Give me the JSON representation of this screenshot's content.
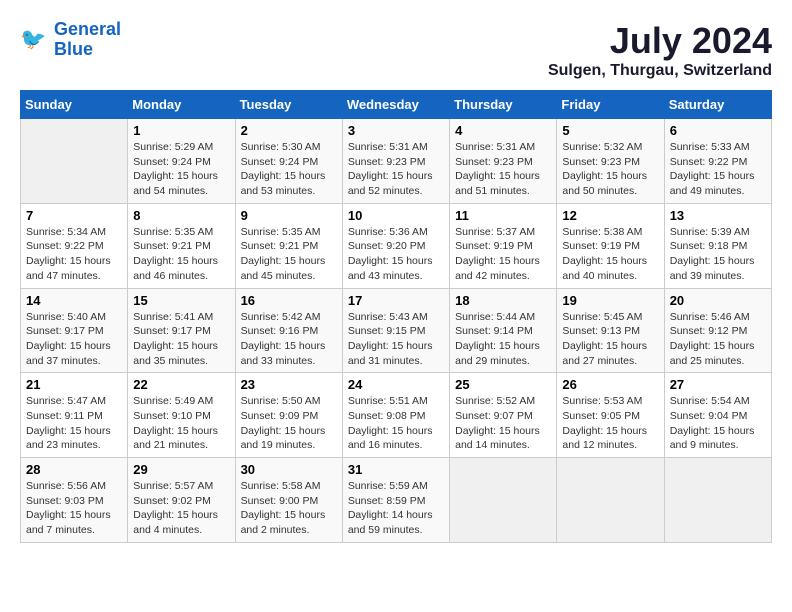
{
  "header": {
    "logo_line1": "General",
    "logo_line2": "Blue",
    "month_year": "July 2024",
    "location": "Sulgen, Thurgau, Switzerland"
  },
  "columns": [
    "Sunday",
    "Monday",
    "Tuesday",
    "Wednesday",
    "Thursday",
    "Friday",
    "Saturday"
  ],
  "weeks": [
    [
      {
        "day": "",
        "info": ""
      },
      {
        "day": "1",
        "info": "Sunrise: 5:29 AM\nSunset: 9:24 PM\nDaylight: 15 hours\nand 54 minutes."
      },
      {
        "day": "2",
        "info": "Sunrise: 5:30 AM\nSunset: 9:24 PM\nDaylight: 15 hours\nand 53 minutes."
      },
      {
        "day": "3",
        "info": "Sunrise: 5:31 AM\nSunset: 9:23 PM\nDaylight: 15 hours\nand 52 minutes."
      },
      {
        "day": "4",
        "info": "Sunrise: 5:31 AM\nSunset: 9:23 PM\nDaylight: 15 hours\nand 51 minutes."
      },
      {
        "day": "5",
        "info": "Sunrise: 5:32 AM\nSunset: 9:23 PM\nDaylight: 15 hours\nand 50 minutes."
      },
      {
        "day": "6",
        "info": "Sunrise: 5:33 AM\nSunset: 9:22 PM\nDaylight: 15 hours\nand 49 minutes."
      }
    ],
    [
      {
        "day": "7",
        "info": "Sunrise: 5:34 AM\nSunset: 9:22 PM\nDaylight: 15 hours\nand 47 minutes."
      },
      {
        "day": "8",
        "info": "Sunrise: 5:35 AM\nSunset: 9:21 PM\nDaylight: 15 hours\nand 46 minutes."
      },
      {
        "day": "9",
        "info": "Sunrise: 5:35 AM\nSunset: 9:21 PM\nDaylight: 15 hours\nand 45 minutes."
      },
      {
        "day": "10",
        "info": "Sunrise: 5:36 AM\nSunset: 9:20 PM\nDaylight: 15 hours\nand 43 minutes."
      },
      {
        "day": "11",
        "info": "Sunrise: 5:37 AM\nSunset: 9:19 PM\nDaylight: 15 hours\nand 42 minutes."
      },
      {
        "day": "12",
        "info": "Sunrise: 5:38 AM\nSunset: 9:19 PM\nDaylight: 15 hours\nand 40 minutes."
      },
      {
        "day": "13",
        "info": "Sunrise: 5:39 AM\nSunset: 9:18 PM\nDaylight: 15 hours\nand 39 minutes."
      }
    ],
    [
      {
        "day": "14",
        "info": "Sunrise: 5:40 AM\nSunset: 9:17 PM\nDaylight: 15 hours\nand 37 minutes."
      },
      {
        "day": "15",
        "info": "Sunrise: 5:41 AM\nSunset: 9:17 PM\nDaylight: 15 hours\nand 35 minutes."
      },
      {
        "day": "16",
        "info": "Sunrise: 5:42 AM\nSunset: 9:16 PM\nDaylight: 15 hours\nand 33 minutes."
      },
      {
        "day": "17",
        "info": "Sunrise: 5:43 AM\nSunset: 9:15 PM\nDaylight: 15 hours\nand 31 minutes."
      },
      {
        "day": "18",
        "info": "Sunrise: 5:44 AM\nSunset: 9:14 PM\nDaylight: 15 hours\nand 29 minutes."
      },
      {
        "day": "19",
        "info": "Sunrise: 5:45 AM\nSunset: 9:13 PM\nDaylight: 15 hours\nand 27 minutes."
      },
      {
        "day": "20",
        "info": "Sunrise: 5:46 AM\nSunset: 9:12 PM\nDaylight: 15 hours\nand 25 minutes."
      }
    ],
    [
      {
        "day": "21",
        "info": "Sunrise: 5:47 AM\nSunset: 9:11 PM\nDaylight: 15 hours\nand 23 minutes."
      },
      {
        "day": "22",
        "info": "Sunrise: 5:49 AM\nSunset: 9:10 PM\nDaylight: 15 hours\nand 21 minutes."
      },
      {
        "day": "23",
        "info": "Sunrise: 5:50 AM\nSunset: 9:09 PM\nDaylight: 15 hours\nand 19 minutes."
      },
      {
        "day": "24",
        "info": "Sunrise: 5:51 AM\nSunset: 9:08 PM\nDaylight: 15 hours\nand 16 minutes."
      },
      {
        "day": "25",
        "info": "Sunrise: 5:52 AM\nSunset: 9:07 PM\nDaylight: 15 hours\nand 14 minutes."
      },
      {
        "day": "26",
        "info": "Sunrise: 5:53 AM\nSunset: 9:05 PM\nDaylight: 15 hours\nand 12 minutes."
      },
      {
        "day": "27",
        "info": "Sunrise: 5:54 AM\nSunset: 9:04 PM\nDaylight: 15 hours\nand 9 minutes."
      }
    ],
    [
      {
        "day": "28",
        "info": "Sunrise: 5:56 AM\nSunset: 9:03 PM\nDaylight: 15 hours\nand 7 minutes."
      },
      {
        "day": "29",
        "info": "Sunrise: 5:57 AM\nSunset: 9:02 PM\nDaylight: 15 hours\nand 4 minutes."
      },
      {
        "day": "30",
        "info": "Sunrise: 5:58 AM\nSunset: 9:00 PM\nDaylight: 15 hours\nand 2 minutes."
      },
      {
        "day": "31",
        "info": "Sunrise: 5:59 AM\nSunset: 8:59 PM\nDaylight: 14 hours\nand 59 minutes."
      },
      {
        "day": "",
        "info": ""
      },
      {
        "day": "",
        "info": ""
      },
      {
        "day": "",
        "info": ""
      }
    ]
  ]
}
